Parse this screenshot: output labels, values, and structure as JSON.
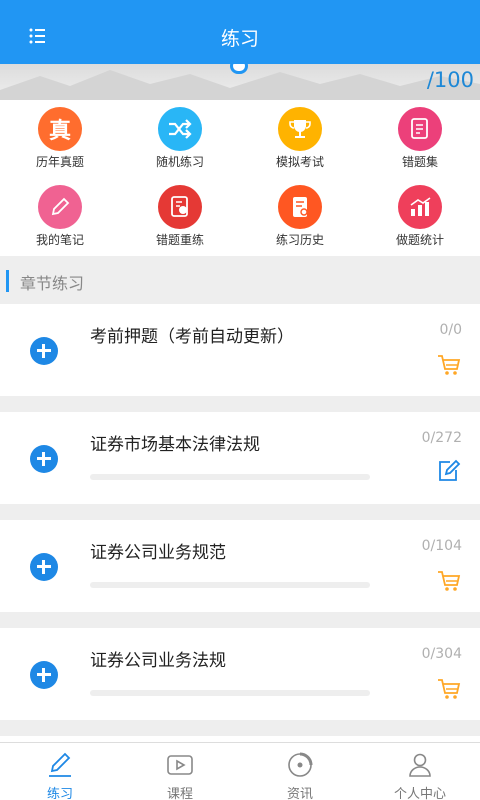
{
  "header": {
    "title": "练习"
  },
  "banner": {
    "score": "/100"
  },
  "features": [
    {
      "label": "历年真题",
      "icon": "zhen-character-icon",
      "glyph": "真",
      "color": "#ff6d2e"
    },
    {
      "label": "随机练习",
      "icon": "shuffle-icon",
      "color": "#29b6f6"
    },
    {
      "label": "模拟考试",
      "icon": "trophy-icon",
      "color": "#ffb300"
    },
    {
      "label": "错题集",
      "icon": "notebook-icon",
      "color": "#ec407a"
    },
    {
      "label": "我的笔记",
      "icon": "pencil-icon",
      "color": "#f06292"
    },
    {
      "label": "错题重练",
      "icon": "retry-notebook-icon",
      "color": "#e53935"
    },
    {
      "label": "练习历史",
      "icon": "history-icon",
      "color": "#ff5722"
    },
    {
      "label": "做题统计",
      "icon": "bar-chart-icon",
      "color": "#ef3f5b"
    }
  ],
  "section": {
    "title": "章节练习"
  },
  "chapters": [
    {
      "name": "考前押题（考前自动更新）",
      "count": "0/0",
      "action": "cart-icon"
    },
    {
      "name": "证券市场基本法律法规",
      "count": "0/272",
      "action": "edit-icon"
    },
    {
      "name": "证券公司业务规范",
      "count": "0/104",
      "action": "cart-icon"
    },
    {
      "name": "证券公司业务法规",
      "count": "0/304",
      "action": "cart-icon"
    }
  ],
  "tabs": [
    {
      "label": "练习",
      "icon": "pen-icon",
      "active": true
    },
    {
      "label": "课程",
      "icon": "video-play-icon",
      "active": false
    },
    {
      "label": "资讯",
      "icon": "disc-icon",
      "active": false
    },
    {
      "label": "个人中心",
      "icon": "person-icon",
      "active": false
    }
  ],
  "colors": {
    "primary": "#2196f3",
    "cart": "#ffa726",
    "edit": "#1e88e5"
  }
}
